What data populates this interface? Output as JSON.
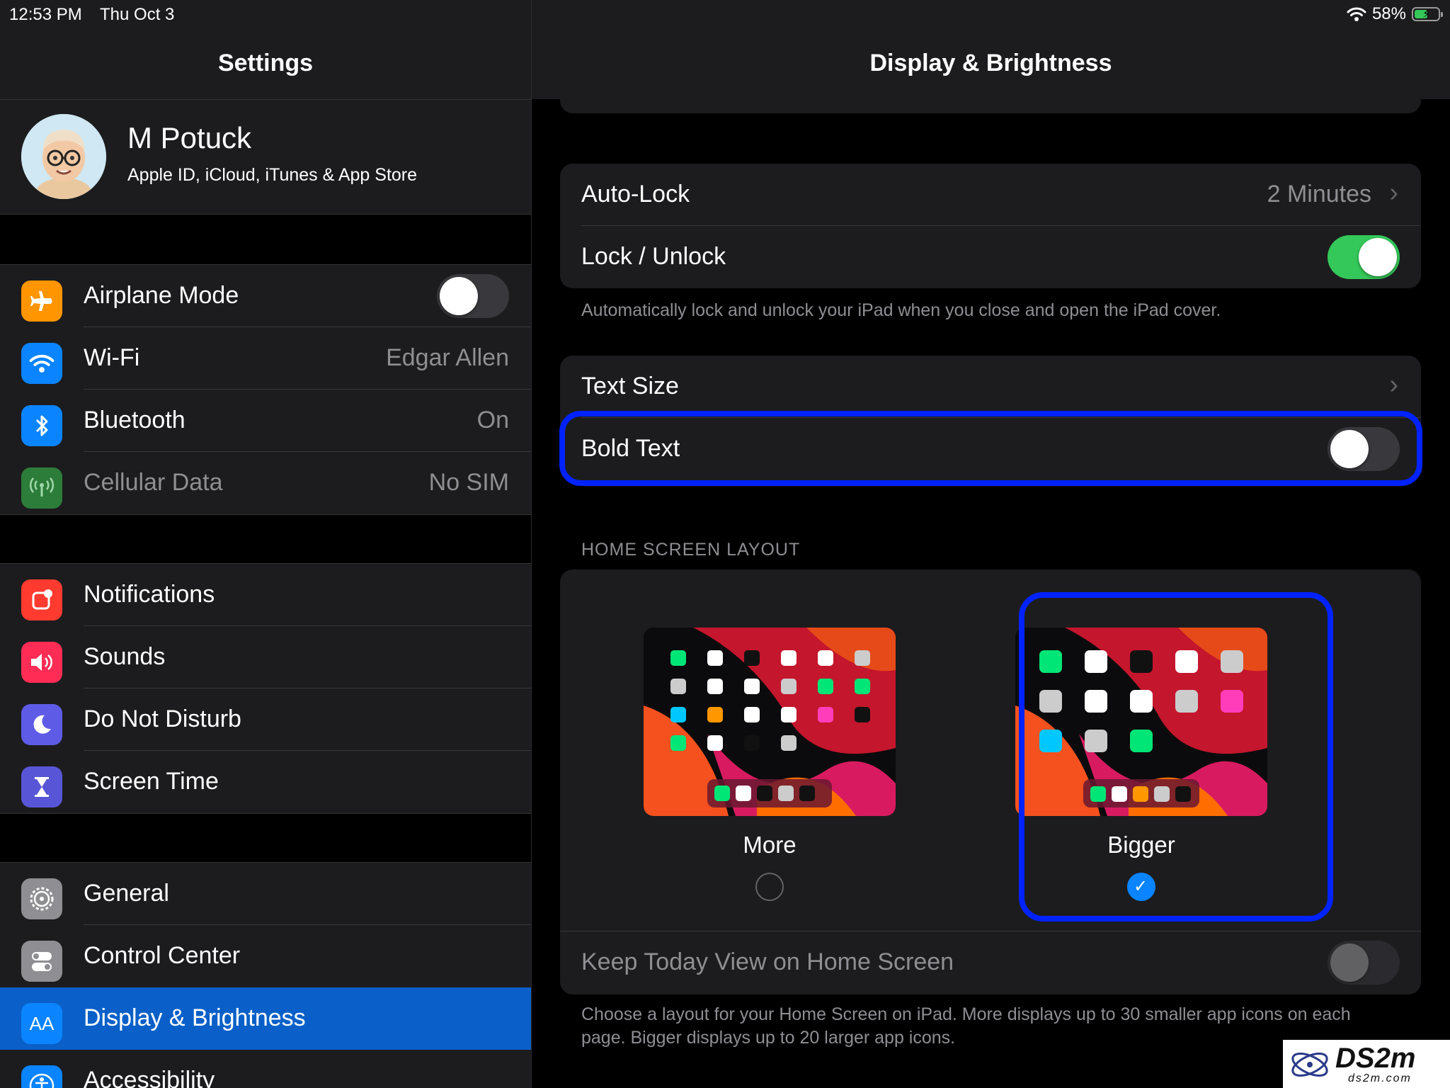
{
  "status_bar": {
    "time": "12:53 PM",
    "date": "Thu Oct 3",
    "battery": "58%",
    "battery_level": 0.58
  },
  "sidebar": {
    "title": "Settings",
    "profile": {
      "name": "M Potuck",
      "subtitle": "Apple ID, iCloud, iTunes & App Store"
    },
    "groups": [
      {
        "items": [
          {
            "label": "Airplane Mode",
            "icon": "airplane-icon",
            "color": "#ff9500",
            "toggle": false
          },
          {
            "label": "Wi-Fi",
            "icon": "wifi-icon",
            "color": "#0a84ff",
            "value": "Edgar Allen"
          },
          {
            "label": "Bluetooth",
            "icon": "bluetooth-icon",
            "color": "#0a84ff",
            "value": "On"
          },
          {
            "label": "Cellular Data",
            "icon": "antenna-icon",
            "color": "#2d7d3a",
            "value": "No SIM",
            "disabled": true
          }
        ]
      },
      {
        "items": [
          {
            "label": "Notifications",
            "icon": "notifications-icon",
            "color": "#ff3b30"
          },
          {
            "label": "Sounds",
            "icon": "speaker-icon",
            "color": "#ff2d55"
          },
          {
            "label": "Do Not Disturb",
            "icon": "moon-icon",
            "color": "#5e5ce6"
          },
          {
            "label": "Screen Time",
            "icon": "hourglass-icon",
            "color": "#5856d6"
          }
        ]
      },
      {
        "items": [
          {
            "label": "General",
            "icon": "gear-icon",
            "color": "#8e8e93"
          },
          {
            "label": "Control Center",
            "icon": "switches-icon",
            "color": "#8e8e93"
          },
          {
            "label": "Display & Brightness",
            "icon": "text-size-icon",
            "color": "#0a84ff",
            "selected": true,
            "icon_text": "AA"
          },
          {
            "label": "Accessibility",
            "icon": "accessibility-icon",
            "color": "#0a84ff"
          }
        ]
      }
    ]
  },
  "detail": {
    "title": "Display & Brightness",
    "autolock": {
      "label": "Auto-Lock",
      "value": "2 Minutes"
    },
    "lock_unlock": {
      "label": "Lock / Unlock",
      "on": true
    },
    "lock_footnote": "Automatically lock and unlock your iPad when you close and open the iPad cover.",
    "text_size": {
      "label": "Text Size"
    },
    "bold_text": {
      "label": "Bold Text",
      "on": false
    },
    "home_layout": {
      "header": "HOME SCREEN LAYOUT",
      "options": [
        {
          "label": "More",
          "selected": false
        },
        {
          "label": "Bigger",
          "selected": true
        }
      ],
      "keep_today": {
        "label": "Keep Today View on Home Screen",
        "on": false,
        "disabled": true
      },
      "footnote": "Choose a layout for your Home Screen on iPad. More displays up to 30 smaller app icons on each page. Bigger displays up to 20 larger app icons."
    }
  },
  "watermark": {
    "text": "DS2m",
    "sub": "ds2m.com"
  },
  "colors": {
    "accent": "#0a84ff",
    "selection": "#0a60c8",
    "toggle_on": "#34c759",
    "highlight": "#0022ff"
  }
}
